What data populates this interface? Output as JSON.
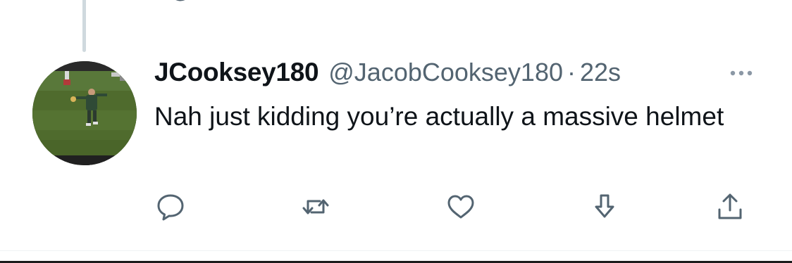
{
  "tweet": {
    "display_name": "JCooksey180",
    "handle": "@JacobCooksey180",
    "separator": "·",
    "timestamp": "22s",
    "text": "Nah just kidding you’re actually a massive helmet"
  },
  "icons": {
    "more": "more-options-icon",
    "reply": "reply-icon",
    "retweet": "retweet-icon",
    "like": "like-icon",
    "download": "download-icon",
    "share": "share-icon"
  },
  "colors": {
    "text_primary": "#0f1419",
    "text_secondary": "#536471",
    "icon": "#536471",
    "thread_line": "#cfd9de",
    "divider": "#eff3f4"
  }
}
